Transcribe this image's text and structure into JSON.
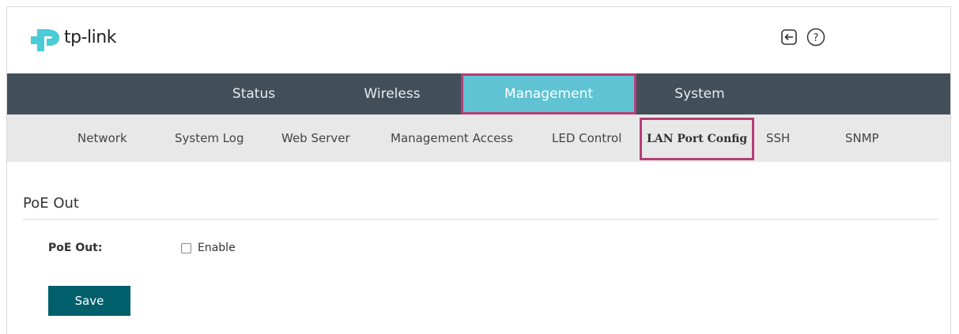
{
  "brand": {
    "name": "tp-link",
    "color": "#4acbd6"
  },
  "header": {
    "logout_icon": "logout-icon",
    "help_icon": "help-icon",
    "help_glyph": "?"
  },
  "main_nav": {
    "tabs": [
      {
        "label": "Status"
      },
      {
        "label": "Wireless"
      },
      {
        "label": "Management",
        "active": true
      },
      {
        "label": "System"
      }
    ],
    "bg_color": "#424f59",
    "active_color": "#60c3d4",
    "highlight_color": "#b73d78"
  },
  "sub_nav": {
    "items": [
      {
        "label": "Network"
      },
      {
        "label": "System Log"
      },
      {
        "label": "Web Server"
      },
      {
        "label": "Management Access"
      },
      {
        "label": "LED Control"
      },
      {
        "label": "LAN Port Config",
        "active": true
      },
      {
        "label": "SSH"
      },
      {
        "label": "SNMP"
      }
    ]
  },
  "content": {
    "section_title": "PoE Out",
    "field_label": "PoE Out:",
    "checkbox_label": "Enable",
    "checkbox_checked": false,
    "save_label": "Save",
    "save_color": "#005f6b"
  }
}
